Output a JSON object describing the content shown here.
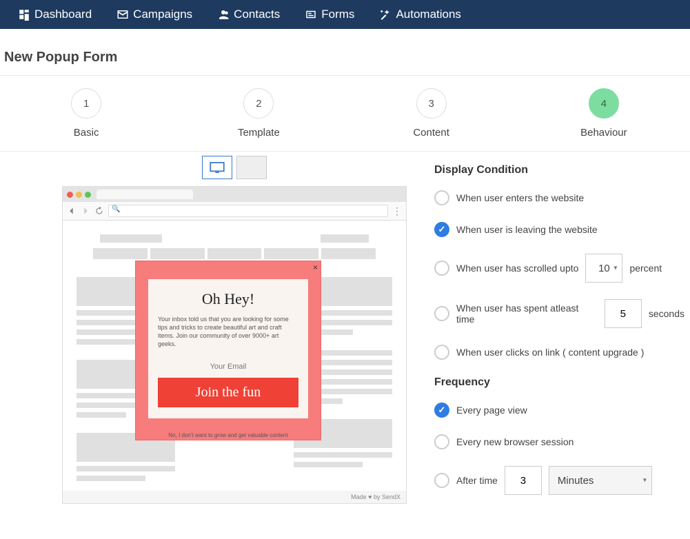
{
  "nav": {
    "items": [
      {
        "label": "Dashboard"
      },
      {
        "label": "Campaigns"
      },
      {
        "label": "Contacts"
      },
      {
        "label": "Forms"
      },
      {
        "label": "Automations"
      }
    ]
  },
  "page": {
    "title": "New Popup Form"
  },
  "steps": [
    {
      "num": "1",
      "label": "Basic"
    },
    {
      "num": "2",
      "label": "Template"
    },
    {
      "num": "3",
      "label": "Content"
    },
    {
      "num": "4",
      "label": "Behaviour"
    }
  ],
  "popup": {
    "title": "Oh Hey!",
    "text": "Your inbox told us that you are looking for some tips and tricks to create beautiful art and craft items. Join our community of over 9000+ art geeks.",
    "input_placeholder": "Your Email",
    "button": "Join the fun",
    "decline": "No, I don't want to grow and get valuable content",
    "credit": "Made ♥ by SendX"
  },
  "behaviour": {
    "display_condition_heading": "Display Condition",
    "conditions": {
      "enter": "When user enters the website",
      "leave": "When user is leaving the website",
      "scroll_pre": "When user has scrolled upto",
      "scroll_value": "10",
      "scroll_post": "percent",
      "time_pre": "When user has spent atleast time",
      "time_value": "5",
      "time_post": "seconds",
      "link": "When user clicks on link ( content upgrade )"
    },
    "frequency_heading": "Frequency",
    "frequency": {
      "every_view": "Every page view",
      "every_session": "Every new browser session",
      "after_time_label": "After time",
      "after_time_value": "3",
      "after_time_unit": "Minutes"
    }
  }
}
